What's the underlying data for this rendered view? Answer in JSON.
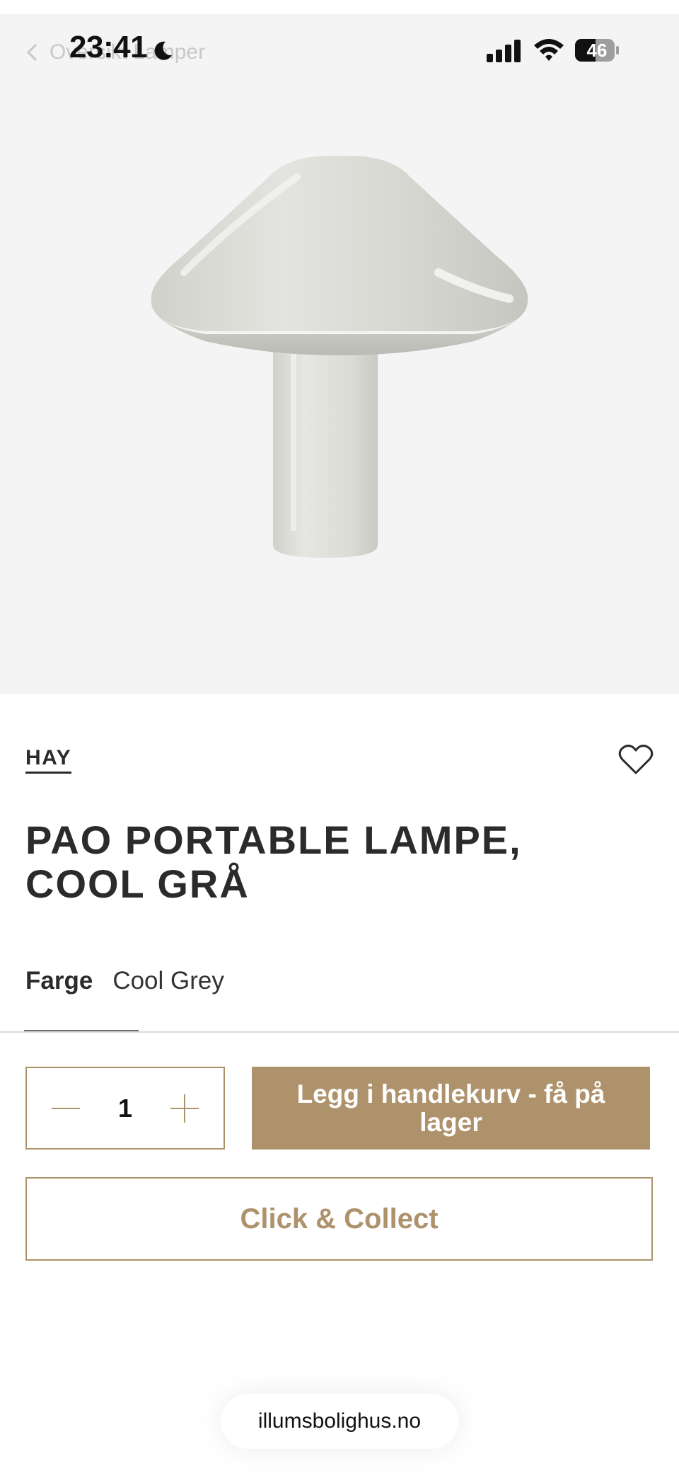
{
  "status_bar": {
    "time": "23:41",
    "battery": "46"
  },
  "breadcrumb": {
    "label": "Oversikt Lamper"
  },
  "product": {
    "brand": "HAY",
    "title": "PAO PORTABLE LAMPE, COOL GRÅ",
    "image_icon": "mushroom-lamp-image",
    "option_label": "Farge",
    "option_value": "Cool Grey"
  },
  "quantity": {
    "value": "1"
  },
  "actions": {
    "add_to_cart": "Legg i handlekurv - få på lager",
    "click_collect": "Click & Collect"
  },
  "browser": {
    "url": "illumsbolighus.no"
  },
  "colors": {
    "accent": "#ae926c",
    "hero_bg": "#f4f4f4",
    "text": "#2b2b2b"
  }
}
